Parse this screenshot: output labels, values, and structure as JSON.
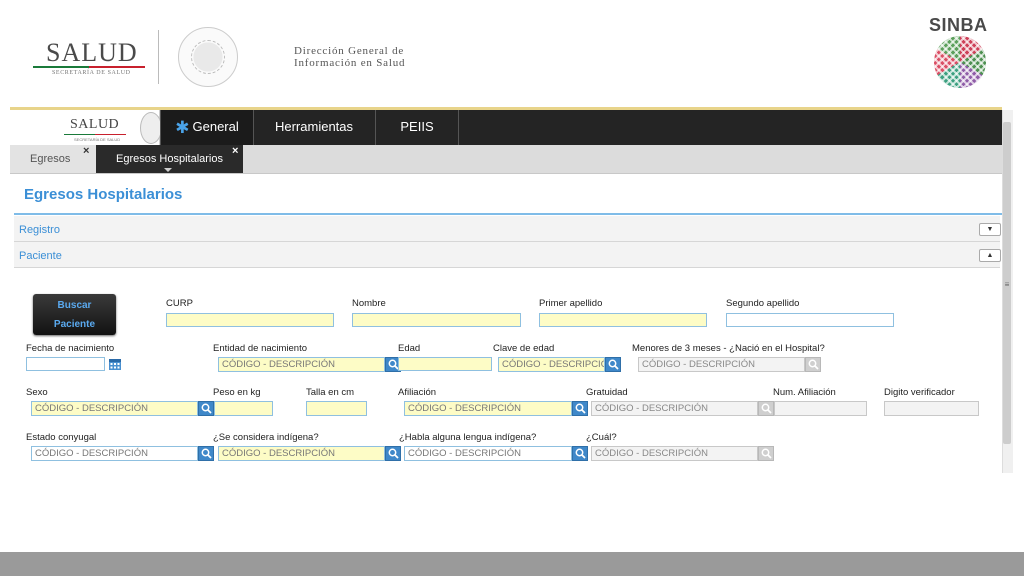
{
  "branding": {
    "salud": "SALUD",
    "salud_sub": "SECRETARÍA DE SALUD",
    "dg_line1": "Dirección General de",
    "dg_line2": "Información en Salud",
    "sinba": "SINBA"
  },
  "navbar": {
    "logo_text": "SALUD",
    "logo_sub": "SECRETARÍA DE SALUD",
    "items": [
      "General",
      "Herramientas",
      "PEIIS"
    ]
  },
  "tabs": [
    {
      "label": "Egresos",
      "close": "×"
    },
    {
      "label": "Egresos Hospitalarios",
      "close": "×"
    }
  ],
  "page": {
    "title": "Egresos Hospitalarios",
    "sections": [
      {
        "label": "Registro",
        "toggle": "▼"
      },
      {
        "label": "Paciente",
        "toggle": "▲"
      }
    ]
  },
  "search_button": {
    "line1": "Buscar",
    "line2": "Paciente"
  },
  "placeholder": "CÓDIGO - DESCRIPCIÓN",
  "form": {
    "curp": "CURP",
    "nombre": "Nombre",
    "primer_apellido": "Primer apellido",
    "segundo_apellido": "Segundo apellido",
    "fecha_nacimiento": "Fecha de nacimiento",
    "entidad_nacimiento": "Entidad de nacimiento",
    "edad": "Edad",
    "clave_edad": "Clave de edad",
    "menores_3_meses": "Menores de 3 meses - ¿Nació en el Hospital?",
    "sexo": "Sexo",
    "peso": "Peso en kg",
    "talla": "Talla en cm",
    "afiliacion": "Afiliación",
    "gratuidad": "Gratuidad",
    "num_afiliacion": "Num. Afiliación",
    "digito_verificador": "Digito verificador",
    "estado_conyugal": "Estado conyugal",
    "indigena": "¿Se considera indígena?",
    "lengua_indigena": "¿Habla alguna lengua indígena?",
    "cual": "¿Cuál?"
  },
  "colors": {
    "accent": "#3b8fd6",
    "navbar": "#242424",
    "required_field": "#fdfcc6"
  }
}
